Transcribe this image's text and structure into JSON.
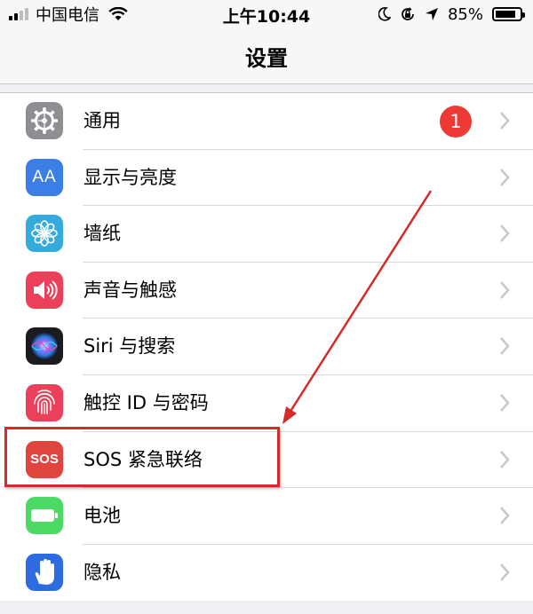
{
  "status_bar": {
    "carrier": "中国电信",
    "time": "上午10:44",
    "battery_percent": "85%",
    "battery_level": 0.85,
    "signal_bars": 4,
    "signal_strength": 2
  },
  "nav": {
    "title": "设置"
  },
  "settings": [
    {
      "label": "通用",
      "icon": "gear-icon",
      "color": "#8e8e93",
      "badge": "1"
    },
    {
      "label": "显示与亮度",
      "icon": "display-aa-icon",
      "color": "#3a7ee6",
      "icon_text": "AA"
    },
    {
      "label": "墙纸",
      "icon": "wallpaper-flower-icon",
      "color": "#35aadc"
    },
    {
      "label": "声音与触感",
      "icon": "speaker-icon",
      "color": "#eb3f5a"
    },
    {
      "label": "Siri 与搜索",
      "icon": "siri-icon",
      "color": "#1c1c1e"
    },
    {
      "label": "触控 ID 与密码",
      "icon": "fingerprint-icon",
      "color": "#eb3f5a"
    },
    {
      "label": "SOS 紧急联络",
      "icon": "sos-icon",
      "color": "#e0443e",
      "icon_text": "SOS"
    },
    {
      "label": "电池",
      "icon": "battery-icon",
      "color": "#4cd964"
    },
    {
      "label": "隐私",
      "icon": "hand-icon",
      "color": "#2f6be0"
    }
  ],
  "annotation": {
    "color": "#d62a2a"
  }
}
